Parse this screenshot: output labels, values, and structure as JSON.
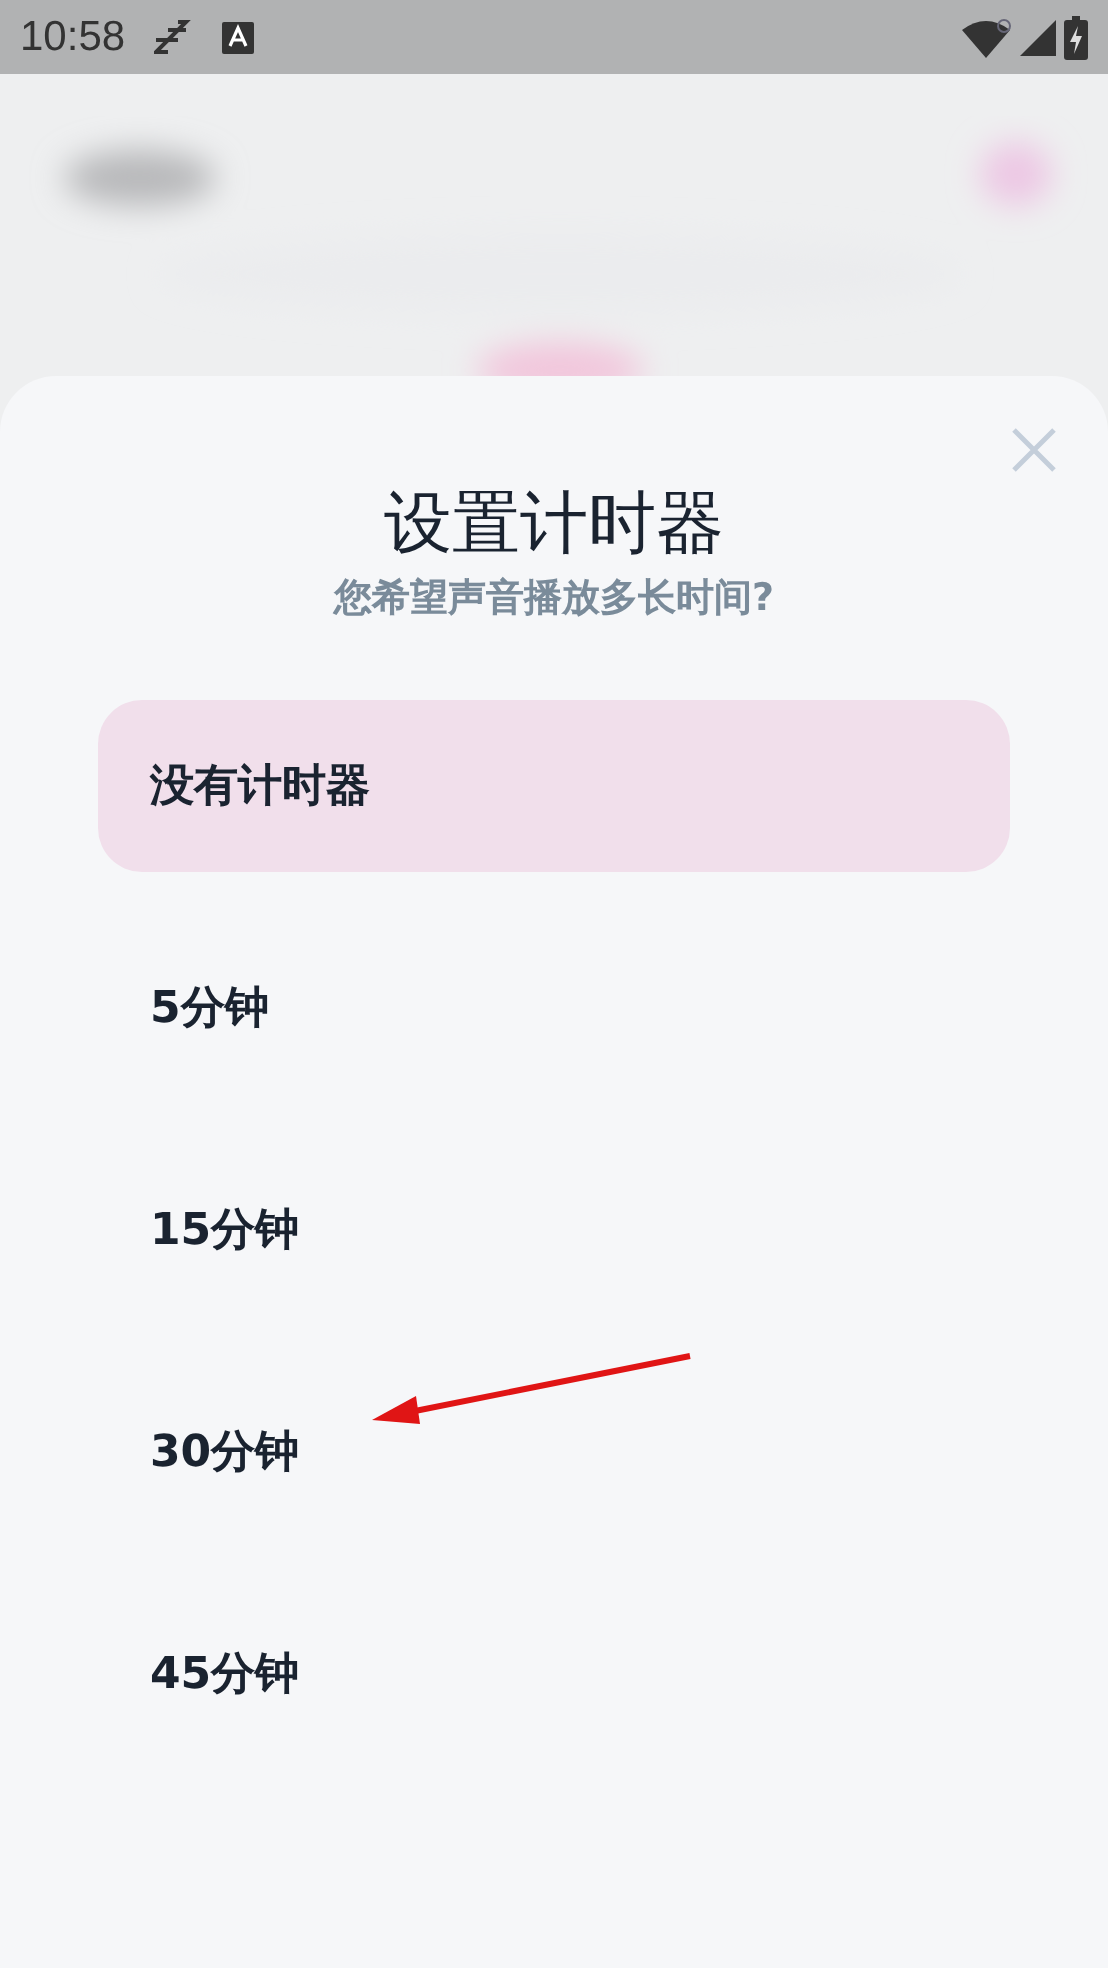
{
  "status_bar": {
    "time": "10:58"
  },
  "sheet": {
    "title": "设置计时器",
    "subtitle": "您希望声音播放多长时间?"
  },
  "options": [
    {
      "label": "没有计时器",
      "selected": true,
      "arrow_pointer": false
    },
    {
      "label": "5分钟",
      "selected": false,
      "arrow_pointer": false
    },
    {
      "label": "15分钟",
      "selected": false,
      "arrow_pointer": false
    },
    {
      "label": "30分钟",
      "selected": false,
      "arrow_pointer": true
    },
    {
      "label": "45分钟",
      "selected": false,
      "arrow_pointer": false
    }
  ]
}
